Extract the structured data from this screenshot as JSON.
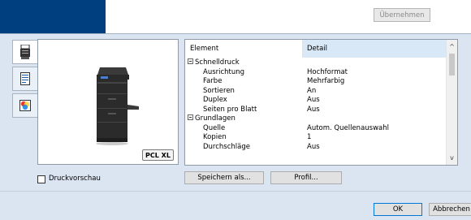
{
  "header": {
    "apply_label": "Übernehmen"
  },
  "tabs": [
    {
      "icon": "printer-icon"
    },
    {
      "icon": "document-icon"
    },
    {
      "icon": "color-icon"
    }
  ],
  "preview": {
    "badge": "PCL XL"
  },
  "details": {
    "columns": {
      "element": "Element",
      "detail": "Detail"
    },
    "rows": [
      {
        "type": "group",
        "label": "Schnelldruck",
        "value": ""
      },
      {
        "type": "item",
        "label": "Ausrichtung",
        "value": "Hochformat"
      },
      {
        "type": "item",
        "label": "Farbe",
        "value": "Mehrfarbig"
      },
      {
        "type": "item",
        "label": "Sortieren",
        "value": "An"
      },
      {
        "type": "item",
        "label": "Duplex",
        "value": "Aus"
      },
      {
        "type": "item",
        "label": "Seiten pro Blatt",
        "value": "Aus"
      },
      {
        "type": "group",
        "label": "Grundlagen",
        "value": ""
      },
      {
        "type": "item",
        "label": "Quelle",
        "value": "Autom. Quellenauswahl"
      },
      {
        "type": "item",
        "label": "Kopien",
        "value": "1"
      },
      {
        "type": "item",
        "label": "Durchschläge",
        "value": "Aus"
      }
    ]
  },
  "controls": {
    "print_preview_label": "Druckvorschau",
    "save_as_label": "Speichern als...",
    "profile_label": "Profil...",
    "ok_label": "OK",
    "cancel_label": "Abbrechen"
  }
}
